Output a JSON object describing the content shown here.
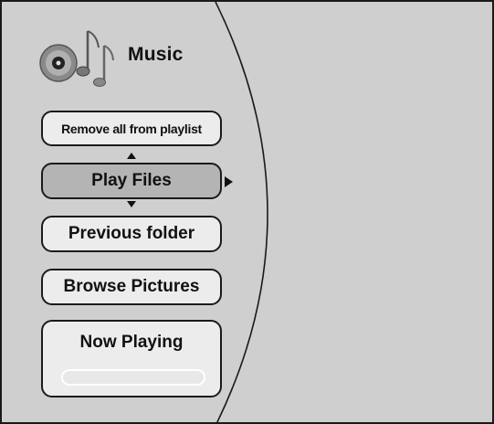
{
  "header": {
    "title": "Music",
    "icon": "music-notes-disc-icon"
  },
  "menu": {
    "items": [
      {
        "label": "Remove all from playlist",
        "selected": false
      },
      {
        "label": "Play Files",
        "selected": true
      },
      {
        "label": "Previous folder",
        "selected": false
      },
      {
        "label": "Browse Pictures",
        "selected": false
      }
    ]
  },
  "now_playing": {
    "label": "Now Playing",
    "progress": 0
  },
  "colors": {
    "background": "#cfcfcf",
    "button": "#ececec",
    "selected_button": "#b4b4b4",
    "outline": "#1a1a1a"
  }
}
